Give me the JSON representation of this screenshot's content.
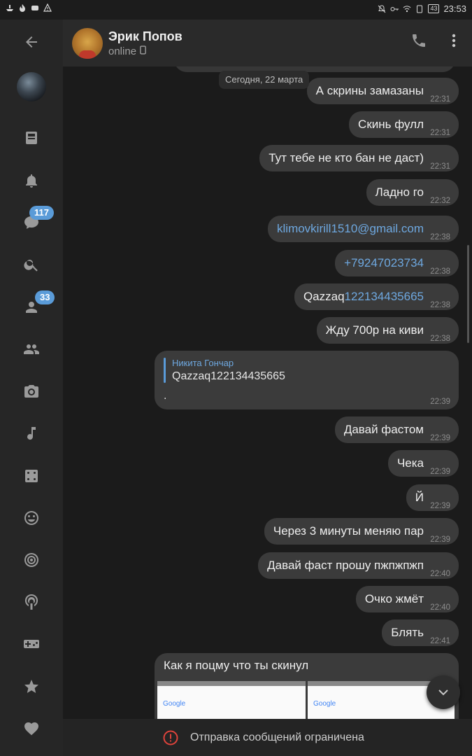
{
  "status_bar": {
    "time": "23:53",
    "battery": "43",
    "left_icons": [
      "boat-icon",
      "flame-icon",
      "game-icon",
      "warning-icon"
    ],
    "right_icons": [
      "mute-icon",
      "key-icon",
      "wifi-icon",
      "sim-icon",
      "battery-icon"
    ]
  },
  "sidebar": {
    "items": [
      {
        "name": "back-arrow-icon"
      },
      {
        "name": "profile-avatar"
      },
      {
        "name": "news-icon"
      },
      {
        "name": "bell-icon"
      },
      {
        "name": "messages-icon",
        "badge": "117"
      },
      {
        "name": "search-icon"
      },
      {
        "name": "friends-icon",
        "badge": "33"
      },
      {
        "name": "groups-icon"
      },
      {
        "name": "camera-icon"
      },
      {
        "name": "music-icon"
      },
      {
        "name": "dice-icon"
      },
      {
        "name": "smile-icon"
      },
      {
        "name": "target-icon"
      },
      {
        "name": "podcast-icon"
      },
      {
        "name": "gamepad-icon"
      },
      {
        "name": "star-icon"
      },
      {
        "name": "heart-icon"
      }
    ]
  },
  "header": {
    "name": "Эрик Попов",
    "status": "online",
    "icons": [
      "phone-icon",
      "more-vertical-icon"
    ]
  },
  "chat": {
    "date": "Сегодня, 22 марта",
    "messages": [
      {
        "text": "А скрины замазаны",
        "time": "22:31"
      },
      {
        "text": "Скинь фулл",
        "time": "22:31"
      },
      {
        "text": "Тут тебе не кто бан не даст)",
        "time": "22:31"
      },
      {
        "text": "Ладно го",
        "time": "22:32"
      },
      {
        "text": "klimovkirill1510@gmail.com",
        "time": "22:38",
        "is_link": true
      },
      {
        "text": "+79247023734",
        "time": "22:38",
        "is_link": true
      },
      {
        "prefix": "Qazzaq",
        "link": "122134435665",
        "time": "22:38"
      },
      {
        "text": "Жду 700р на киви",
        "time": "22:38"
      }
    ],
    "reply": {
      "author": "Никита Гончар",
      "quoted": "Qazzaq122134435665",
      "text": ".",
      "time": "22:39"
    },
    "messages_after": [
      {
        "text": "Давай фастом",
        "time": "22:39"
      },
      {
        "text": "Чека",
        "time": "22:39"
      },
      {
        "text": "Й",
        "time": "22:39"
      },
      {
        "text": "Через 3 минуты меняю пар",
        "time": "22:39"
      },
      {
        "text": "Давай фаст прошу пжпжпжп",
        "time": "22:40"
      },
      {
        "text": "Очко жмёт",
        "time": "22:40"
      },
      {
        "text": "Блять",
        "time": "22:41"
      }
    ],
    "photo_message": {
      "text": "Как я поцму что ты скинул",
      "thumb_label": "Google"
    }
  },
  "composer": {
    "restricted_text": "Отправка сообщений ограничена"
  },
  "colors": {
    "accent": "#5a9bd8",
    "bubble": "#3b3b3b",
    "background": "#1b1b1b",
    "warning": "#e0433b"
  }
}
